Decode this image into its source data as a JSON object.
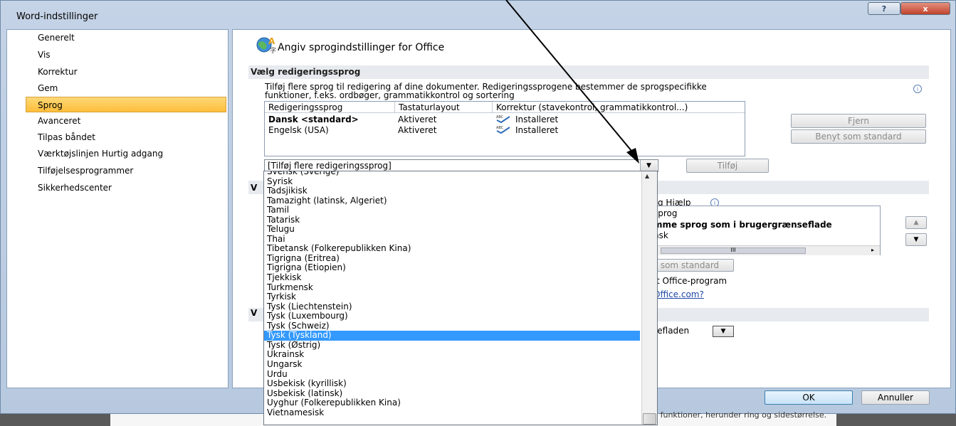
{
  "window": {
    "title": "Word-indstillinger",
    "help_label": "?",
    "close_label": "x"
  },
  "nav": {
    "items": [
      {
        "label": "Generelt"
      },
      {
        "label": "Vis"
      },
      {
        "label": "Korrektur"
      },
      {
        "label": "Gem"
      },
      {
        "label": "Sprog"
      },
      {
        "label": "Avanceret"
      },
      {
        "label": "Tilpas båndet"
      },
      {
        "label": "Værktøjslinjen Hurtig adgang"
      },
      {
        "label": "Tilføjelsesprogrammer"
      },
      {
        "label": "Sikkerhedscenter"
      }
    ],
    "selected": "Sprog"
  },
  "main": {
    "title": "Angiv sprogindstillinger for Office",
    "section1": "Vælg redigeringssprog",
    "description_line1": "Tilføj flere sprog til redigering af dine dokumenter. Redigeringssprogene bestemmer de sprogspecifikke",
    "description_line2": "funktioner, f.eks. ordbøger, grammatikkontrol og sortering",
    "table": {
      "headers": [
        "Redigeringssprog",
        "Tastaturlayout",
        "Korrektur (stavekontrol, grammatikkontrol...)"
      ],
      "rows": [
        {
          "lang": "Dansk <standard>",
          "layout": "Aktiveret",
          "proof": "Installeret"
        },
        {
          "lang": "Engelsk (USA)",
          "layout": "Aktiveret",
          "proof": "Installeret"
        }
      ]
    },
    "remove_label": "Fjern",
    "set_default_label": "Benyt som standard",
    "combo_value": "[Tilføj flere redigeringssprog]",
    "add_label": "Tilføj",
    "section2_prefix": "V",
    "section3_prefix": "V",
    "help_lang_label": "g Hjælp",
    "help_list": [
      "sprog",
      "mme sprog som i brugergrænseflade",
      "nsk"
    ],
    "hscroll_label": "III",
    "std_button2": "som standard",
    "office_prog_text": "ft Office-program",
    "office_link": "Office.com?",
    "ui_combo_value": "sefladen",
    "ok_label": "OK",
    "cancel_label": "Annuller",
    "bottom_text": "kke funktioner, herunder ring og sidestørrelse."
  },
  "dropdown": {
    "partial_top": "Svensk (Sverige)",
    "items": [
      "Syrisk",
      "Tadsjikisk",
      "Tamazight (latinsk, Algeriet)",
      "Tamil",
      "Tatarisk",
      "Telugu",
      "Thai",
      "Tibetansk (Folkerepublikken Kina)",
      "Tigrigna (Eritrea)",
      "Tigrigna (Etiopien)",
      "Tjekkisk",
      "Turkmensk",
      "Tyrkisk",
      "Tysk (Liechtenstein)",
      "Tysk (Luxembourg)",
      "Tysk (Schweiz)",
      "Tysk (Tyskland)",
      "Tysk (Østrig)",
      "Ukrainsk",
      "Ungarsk",
      "Urdu",
      "Usbekisk (kyrillisk)",
      "Usbekisk (latinsk)",
      "Uyghur (Folkerepublikken Kina)",
      "Vietnamesisk"
    ],
    "selected": "Tysk (Tyskland)"
  },
  "colors": {
    "selection": "#3399ff",
    "nav_selected": "#fdbe3a",
    "link": "#1f47a6"
  }
}
